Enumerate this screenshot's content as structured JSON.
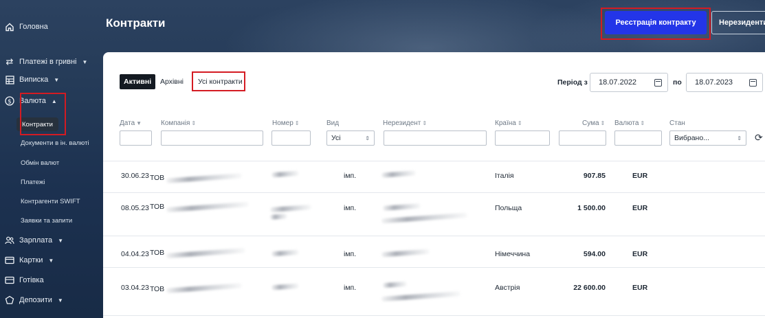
{
  "sidebar": {
    "home": "Головна",
    "payments_uah": "Платежі в гривні",
    "statement": "Виписка",
    "currency": "Валюта",
    "sub": {
      "contracts": "Контракти",
      "fx_documents": "Документи в ін. валюті",
      "fx_exchange": "Обмін валют",
      "payments": "Платежі",
      "swift": "Контрагенти SWIFT",
      "requests": "Заявки та запити"
    },
    "salary": "Зарплата",
    "cards": "Картки",
    "cash": "Готівка",
    "deposits": "Депозити"
  },
  "header": {
    "title": "Контракти",
    "register_button": "Реєстрація контракту",
    "nonresidents_button": "Нерезиденти"
  },
  "tabs": {
    "active": "Активні",
    "archived": "Архівні",
    "all": "Усі контракти"
  },
  "period": {
    "from_label": "Період з",
    "from_value": "18.07.2022",
    "to_label": "по",
    "to_value": "18.07.2023"
  },
  "columns": {
    "date": "Дата",
    "company": "Компанія",
    "number": "Номер",
    "type": "Вид",
    "nonresident": "Нерезидент",
    "country": "Країна",
    "amount": "Сума",
    "currency": "Валюта",
    "state": "Стан"
  },
  "filters": {
    "type_value": "Усі",
    "state_value": "Вибрано..."
  },
  "rows": [
    {
      "date": "30.06.23",
      "company": "ТОВ",
      "type": "імп.",
      "country": "Італія",
      "amount": "907.85",
      "currency": "EUR"
    },
    {
      "date": "08.05.23",
      "company": "ТОВ",
      "type": "імп.",
      "country": "Польща",
      "amount": "1 500.00",
      "currency": "EUR"
    },
    {
      "date": "04.04.23",
      "company": "ТОВ",
      "type": "імп.",
      "country": "Німеччина",
      "amount": "594.00",
      "currency": "EUR"
    },
    {
      "date": "03.04.23",
      "company": "ТОВ",
      "type": "імп.",
      "country": "Австрія",
      "amount": "22 600.00",
      "currency": "EUR"
    }
  ],
  "icons": {
    "home": "home-icon",
    "transfer": "transfer-arrows-icon",
    "statement": "table-icon",
    "currency": "dollar-circle-icon",
    "salary": "people-icon",
    "cards": "card-icon",
    "cash": "cash-icon",
    "deposits": "deposit-icon",
    "calendar": "calendar-icon",
    "refresh": "refresh-icon"
  },
  "colors": {
    "primary_button": "#2335e8",
    "highlight_box": "#d41b22",
    "active_tab": "#141a22"
  }
}
